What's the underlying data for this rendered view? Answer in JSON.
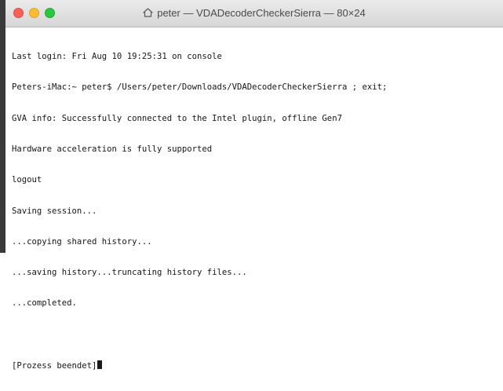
{
  "window": {
    "title": "peter — VDADecoderCheckerSierra — 80×24",
    "title_icon": "home-folder-icon"
  },
  "terminal": {
    "lines": [
      "Last login: Fri Aug 10 19:25:31 on console",
      "Peters-iMac:~ peter$ /Users/peter/Downloads/VDADecoderCheckerSierra ; exit;",
      "GVA info: Successfully connected to the Intel plugin, offline Gen7",
      "Hardware acceleration is fully supported",
      "logout",
      "Saving session...",
      "...copying shared history...",
      "...saving history...truncating history files...",
      "...completed.",
      "",
      "[Prozess beendet]"
    ]
  },
  "colors": {
    "close": "#fc5f57",
    "minimize": "#fdbc2e",
    "zoom": "#29c840",
    "text": "#161616",
    "background": "#ffffff"
  }
}
